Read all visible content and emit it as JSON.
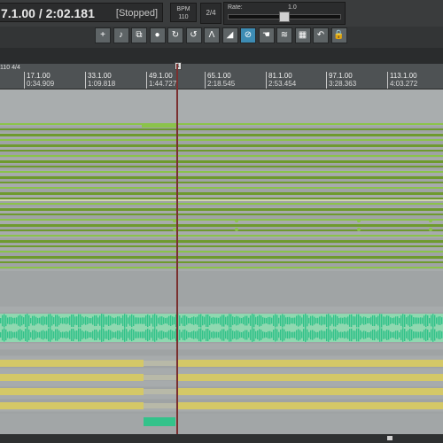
{
  "transport": {
    "position": "7.1.00 / 2:02.181",
    "status": "[Stopped]",
    "bpm_label": "BPM",
    "bpm_value": "110",
    "time_signature": "2/4",
    "rate_label": "Rate:",
    "rate_value": "1.0",
    "rate_level": 0.5
  },
  "toolbar": {
    "buttons": [
      {
        "icon": "new-track-icon",
        "glyph": "+"
      },
      {
        "icon": "new-midi-icon",
        "glyph": "♪"
      },
      {
        "icon": "glue-icon",
        "glyph": "⧉"
      },
      {
        "icon": "record-icon",
        "glyph": "●"
      },
      {
        "icon": "loop-icon",
        "glyph": "↻"
      },
      {
        "icon": "loop-green-icon",
        "glyph": "↺"
      },
      {
        "icon": "metronome-icon",
        "glyph": "Λ"
      },
      {
        "icon": "split-icon",
        "glyph": "◢"
      },
      {
        "icon": "ripple-edit-icon",
        "glyph": "⊘",
        "active": true
      },
      {
        "icon": "grid-hand-icon",
        "glyph": "☚"
      },
      {
        "icon": "envelope-icon",
        "glyph": "≋"
      },
      {
        "icon": "grid-icon",
        "glyph": "▦"
      },
      {
        "icon": "undo-icon",
        "glyph": "↶"
      },
      {
        "icon": "lock-icon",
        "glyph": "🔒"
      }
    ]
  },
  "ruler": {
    "tempo_sig": "110 4/4",
    "markers": [
      {
        "bar": "17.1.00",
        "time": "0:34.909"
      },
      {
        "bar": "33.1.00",
        "time": "1:09.818"
      },
      {
        "bar": "49.1.00",
        "time": "1:44.727"
      },
      {
        "bar": "65.1.00",
        "time": "2:18.545"
      },
      {
        "bar": "81.1.00",
        "time": "2:53.454"
      },
      {
        "bar": "97.1.00",
        "time": "3:28.363"
      },
      {
        "bar": "113.1.00",
        "time": "4:03.272"
      }
    ],
    "region_marker": "1"
  },
  "colors": {
    "lime": "#8bc34a",
    "lime_dark": "#6e9a2e",
    "teal": "#33c28a",
    "yellow": "#d4c867",
    "cursor": "#7a3030"
  }
}
